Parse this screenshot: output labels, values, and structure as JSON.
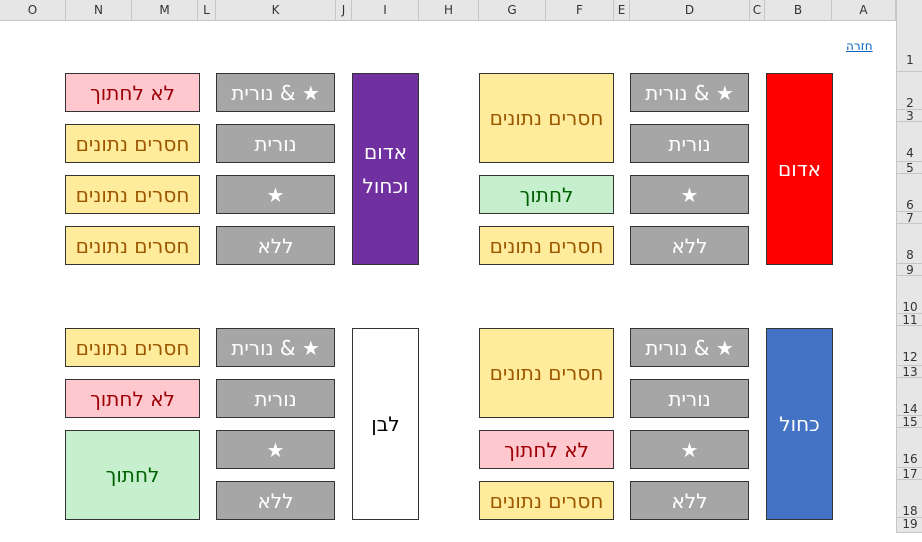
{
  "columns": [
    "O",
    "N",
    "M",
    "L",
    "K",
    "J",
    "I",
    "H",
    "G",
    "F",
    "E",
    "D",
    "C",
    "B",
    "A"
  ],
  "rows": [
    "1",
    "2",
    "3",
    "4",
    "5",
    "6",
    "7",
    "8",
    "9",
    "10",
    "11",
    "12",
    "13",
    "14",
    "15",
    "16",
    "17",
    "18",
    "19"
  ],
  "back_link": "חזרה",
  "groups": {
    "red": {
      "label": "אדום",
      "options": [
        "נורית & ★",
        "נורית",
        "★",
        "ללא"
      ],
      "results": [
        "חסרים נתונים",
        "לחתוך",
        "חסרים נתונים"
      ]
    },
    "purple": {
      "label": "אדום וכחול",
      "options": [
        "נורית & ★",
        "נורית",
        "★",
        "ללא"
      ],
      "results": [
        "לא לחתוך",
        "חסרים נתונים",
        "חסרים נתונים",
        "חסרים נתונים"
      ]
    },
    "blue": {
      "label": "כחול",
      "options": [
        "נורית & ★",
        "נורית",
        "★",
        "ללא"
      ],
      "results": [
        "חסרים נתונים",
        "לא לחתוך",
        "חסרים נתונים"
      ]
    },
    "white": {
      "label": "לבן",
      "options": [
        "נורית & ★",
        "נורית",
        "★",
        "ללא"
      ],
      "results": [
        "חסרים נתונים",
        "לא לחתוך",
        "לחתוך"
      ]
    }
  },
  "colors": {
    "red": "#ff0000",
    "purple": "#7030a0",
    "blue": "#4472c4",
    "neutral_fill": "#ffeb9c",
    "bad_fill": "#ffc7ce",
    "good_fill": "#c6efce",
    "option_fill": "#a6a6a6"
  }
}
